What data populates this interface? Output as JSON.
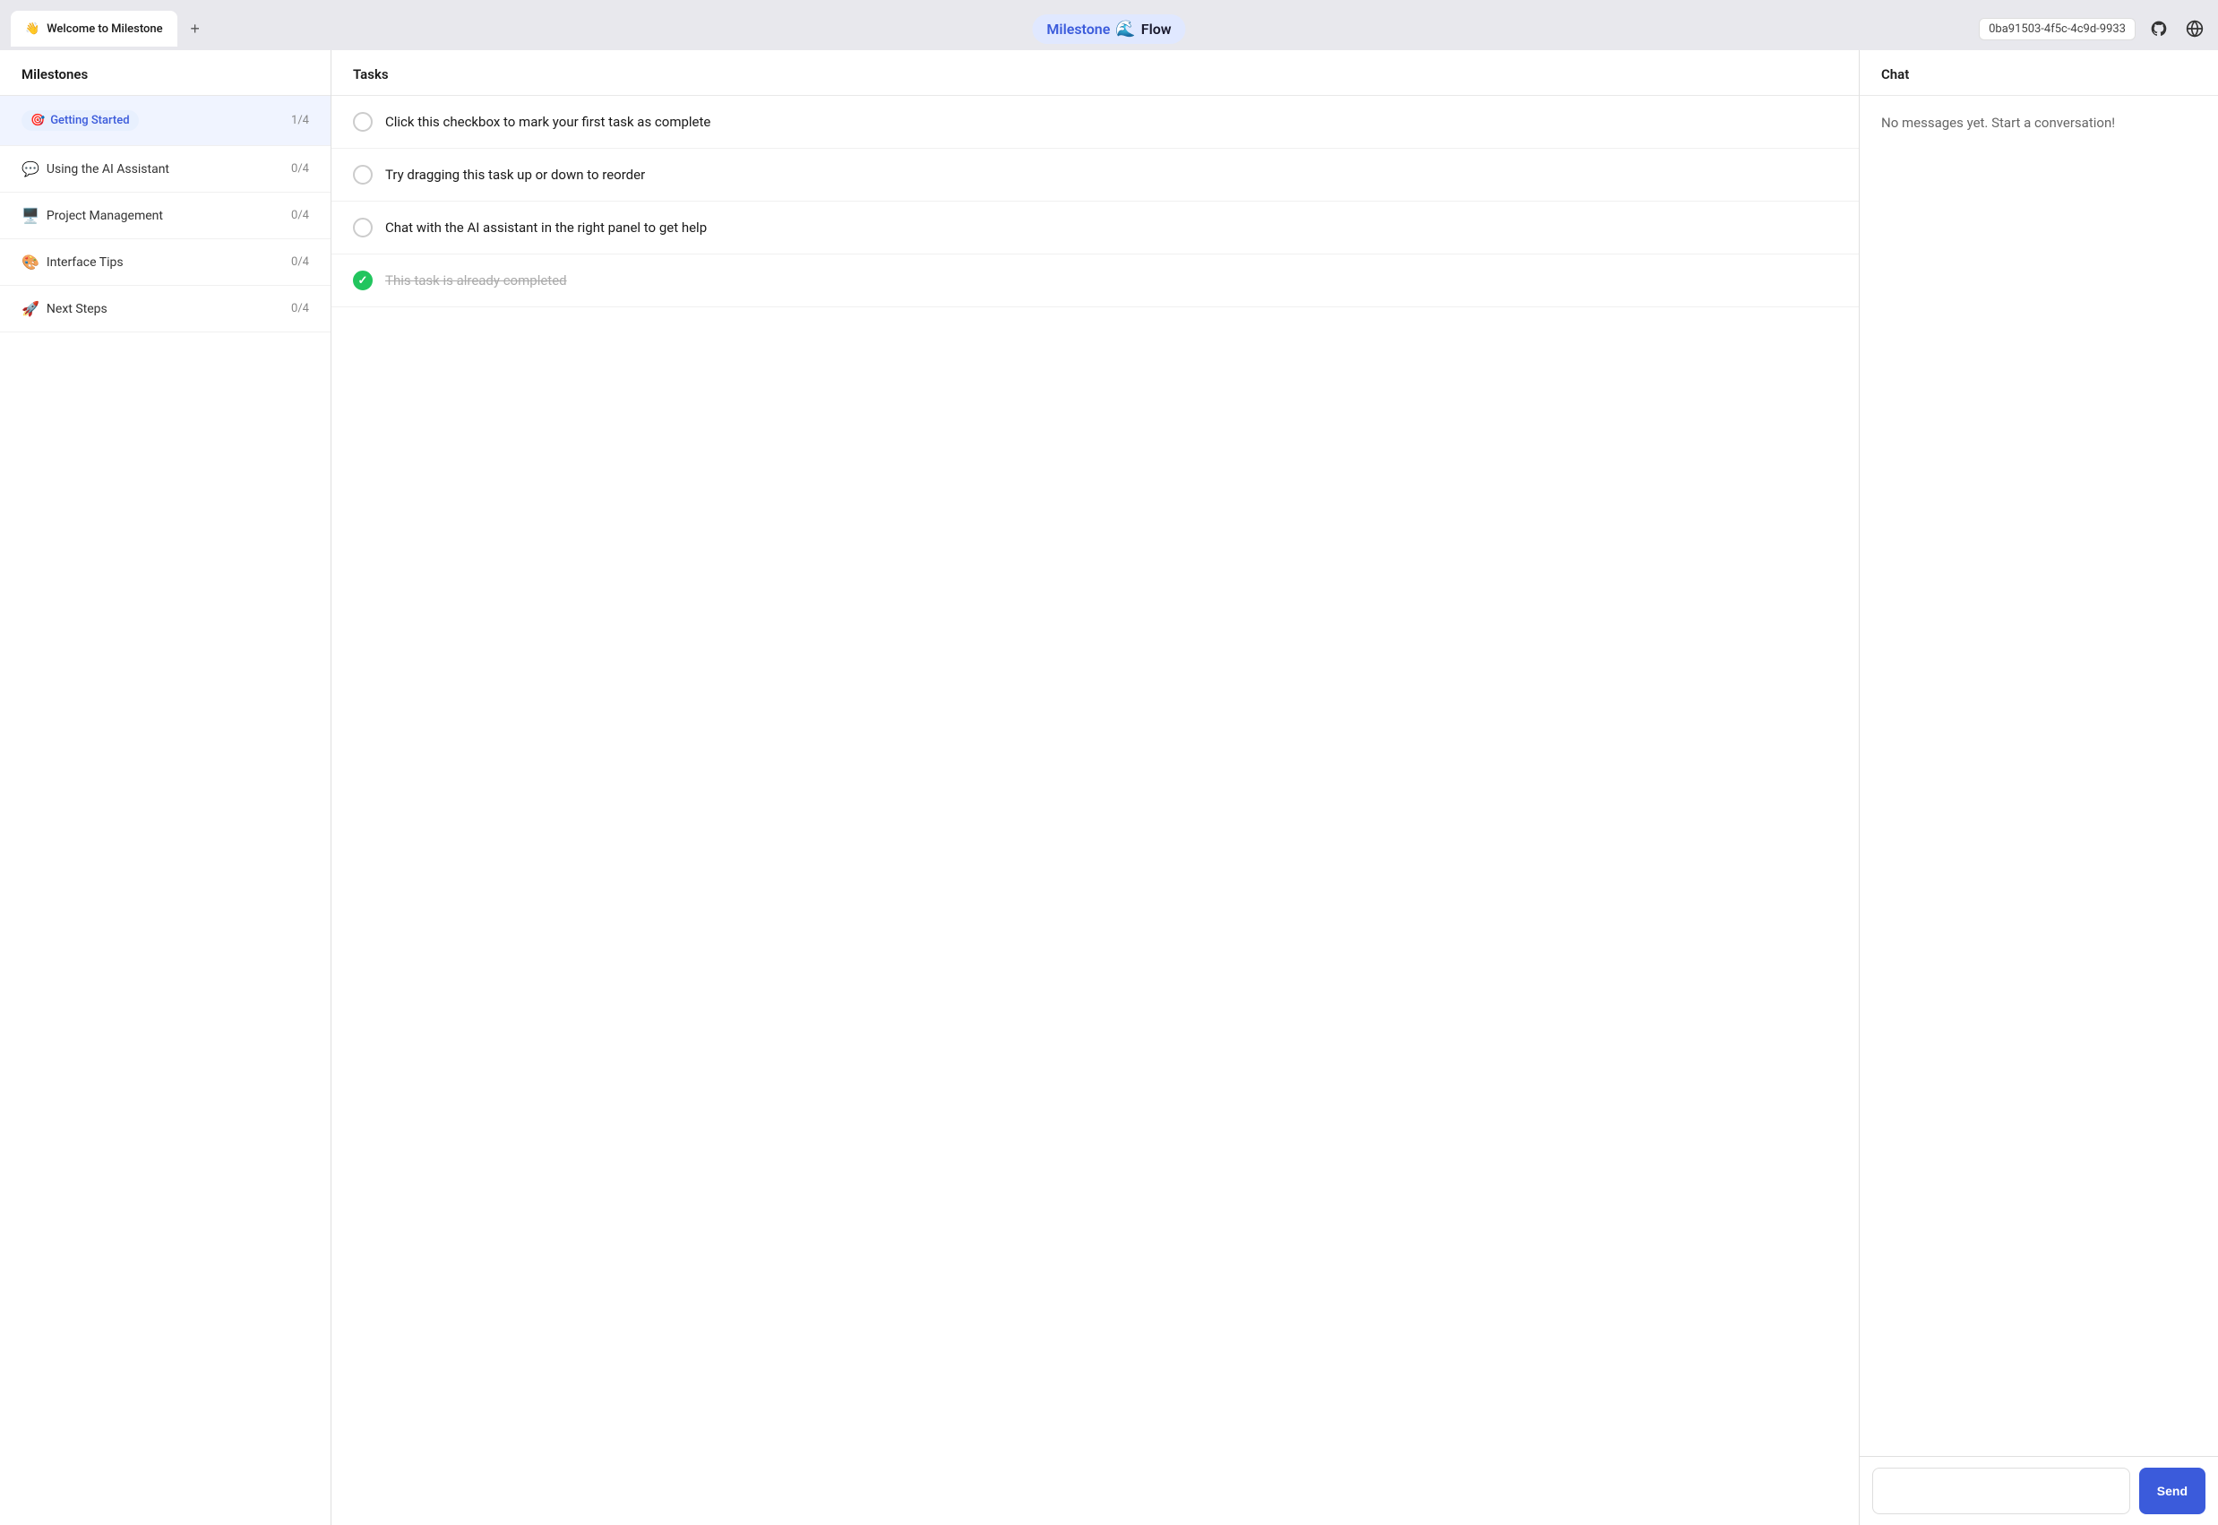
{
  "tabBar": {
    "activeTab": {
      "icon": "👋",
      "label": "Welcome to Milestone"
    },
    "addTabLabel": "+"
  },
  "header": {
    "appTitle": {
      "milestone": "Milestone",
      "logoEmoji": "🌊",
      "flow": "Flow"
    },
    "sessionId": "0ba91503-4f5c-4c9d-9933",
    "githubIconLabel": "github-icon",
    "globeIconLabel": "globe-icon"
  },
  "milestonesPanel": {
    "header": "Milestones",
    "items": [
      {
        "emoji": "🎯",
        "label": "Getting Started",
        "count": "1/4",
        "active": true
      },
      {
        "emoji": "💬",
        "label": "Using the AI Assistant",
        "count": "0/4",
        "active": false
      },
      {
        "emoji": "🖥️",
        "label": "Project Management",
        "count": "0/4",
        "active": false
      },
      {
        "emoji": "🎨",
        "label": "Interface Tips",
        "count": "0/4",
        "active": false
      },
      {
        "emoji": "🚀",
        "label": "Next Steps",
        "count": "0/4",
        "active": false
      }
    ]
  },
  "tasksPanel": {
    "header": "Tasks",
    "tasks": [
      {
        "id": 1,
        "text": "Click this checkbox to mark your first task as complete",
        "completed": false
      },
      {
        "id": 2,
        "text": "Try dragging this task up or down to reorder",
        "completed": false
      },
      {
        "id": 3,
        "text": "Chat with the AI assistant in the right panel to get help",
        "completed": false
      },
      {
        "id": 4,
        "text": "This task is already completed",
        "completed": true
      }
    ]
  },
  "chatPanel": {
    "header": "Chat",
    "emptyMessage": "No messages yet. Start a conversation!",
    "inputPlaceholder": "",
    "sendButtonLabel": "Send"
  }
}
